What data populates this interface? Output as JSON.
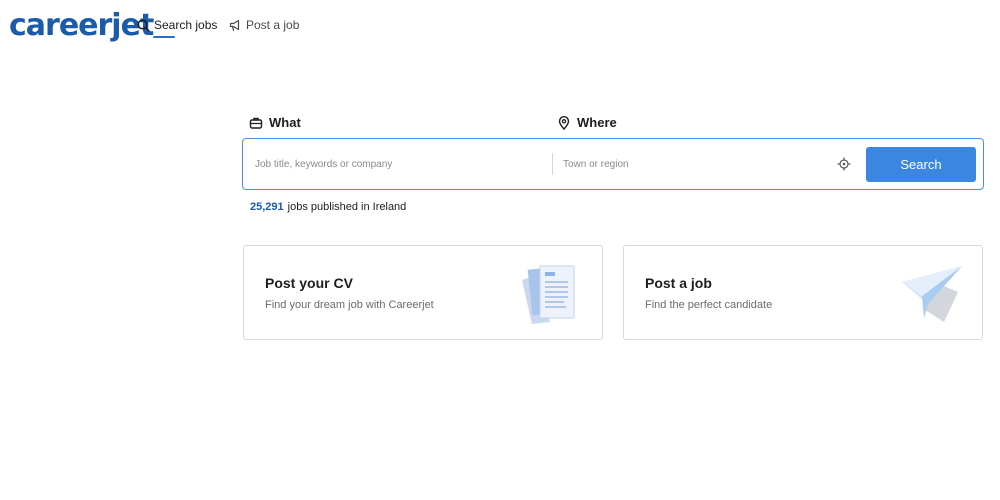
{
  "header": {
    "logo": "careerjet",
    "nav": [
      {
        "label": "Search jobs",
        "icon": "search-icon",
        "active": true
      },
      {
        "label": "Post a job",
        "icon": "megaphone-icon",
        "active": false
      }
    ]
  },
  "search": {
    "what_label": "What",
    "where_label": "Where",
    "what_placeholder": "Job title, keywords or company",
    "where_placeholder": "Town or region",
    "button_label": "Search"
  },
  "stats": {
    "count": "25,291",
    "text": "jobs published in Ireland"
  },
  "cards": [
    {
      "title": "Post your CV",
      "subtitle": "Find your dream job with Careerjet",
      "icon": "cv-document-icon"
    },
    {
      "title": "Post a job",
      "subtitle": "Find the perfect candidate",
      "icon": "paper-plane-icon"
    }
  ],
  "colors": {
    "brand": "#1a5bab",
    "accent": "#3b86e0",
    "border_focus": "#4a90e2"
  }
}
